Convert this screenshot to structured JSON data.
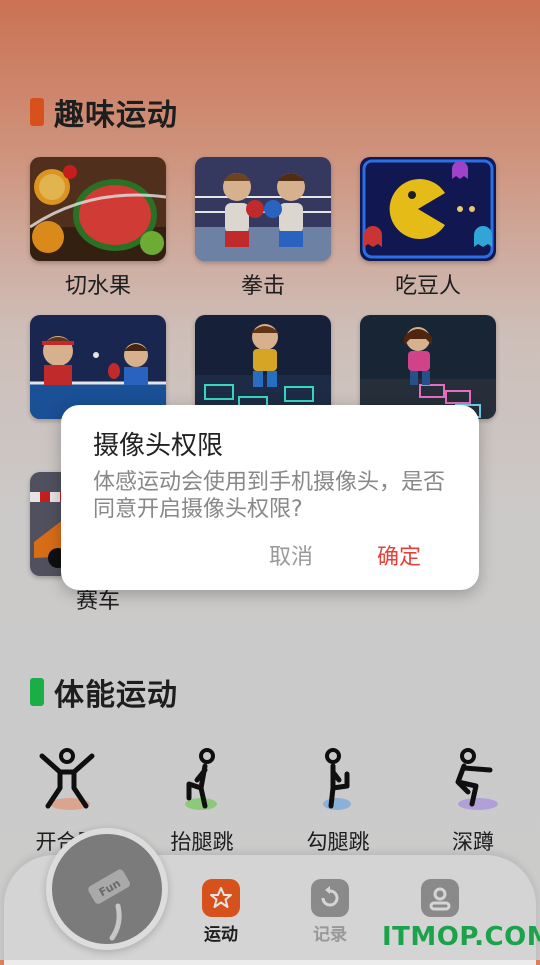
{
  "sections": {
    "fun": {
      "title": "趣味运动",
      "accent": "#ef5b1f"
    },
    "fitness": {
      "title": "体能运动",
      "accent": "#1fc24e"
    }
  },
  "games": [
    {
      "label": "切水果",
      "icon": "fruit-slice-image"
    },
    {
      "label": "拳击",
      "icon": "boxing-image"
    },
    {
      "label": "吃豆人",
      "icon": "pacman-image"
    },
    {
      "label": "",
      "icon": "ping-pong-image"
    },
    {
      "label": "",
      "icon": "dance-floor-image"
    },
    {
      "label": "",
      "icon": "hopscotch-image"
    },
    {
      "label": "赛车",
      "icon": "race-car-image"
    }
  ],
  "fitness": [
    {
      "label": "开合跳",
      "icon": "jumping-jack-icon"
    },
    {
      "label": "抬腿跳",
      "icon": "high-knee-icon"
    },
    {
      "label": "勾腿跳",
      "icon": "butt-kick-icon"
    },
    {
      "label": "深蹲",
      "icon": "squat-icon"
    }
  ],
  "dialog": {
    "title": "摄像头权限",
    "message": "体感运动会使用到手机摄像头，是否同意开启摄像头权限?",
    "cancel": "取消",
    "confirm": "确定"
  },
  "tabbar": {
    "fab_label": "Fun",
    "tabs": [
      {
        "label": "运动",
        "active": true,
        "icon": "star-pentagon-icon"
      },
      {
        "label": "记录",
        "active": false,
        "icon": "refresh-icon"
      },
      {
        "label": "",
        "active": false,
        "icon": "user-icon"
      }
    ]
  },
  "watermark": "ITMOP.COM"
}
